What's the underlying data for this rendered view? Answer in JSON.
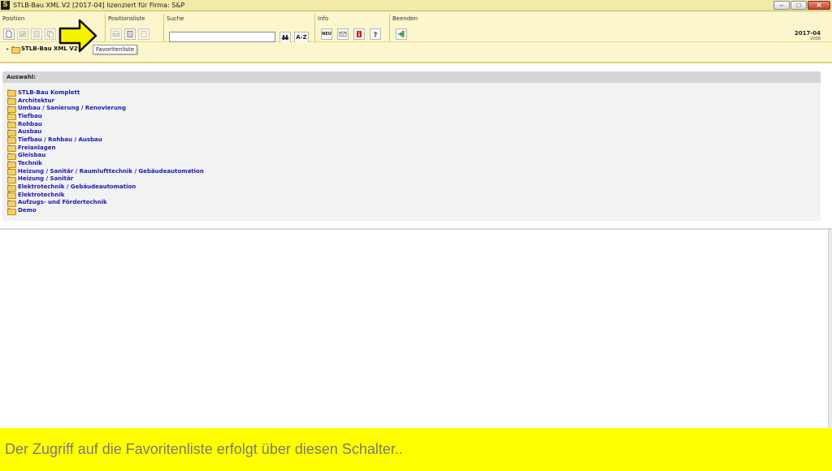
{
  "window": {
    "app_icon": "S",
    "title": "STLB-Bau XML V2 [2017-04] lizenziert für Firma: S&P",
    "controls": {
      "minimize": "–",
      "maximize": "□",
      "close": "✕"
    }
  },
  "ribbon": {
    "groups": {
      "position": {
        "label": "Position"
      },
      "positionsliste": {
        "label": "Positionsliste"
      },
      "suche": {
        "label": "Suche",
        "search_value": "",
        "binoculars_icon": "binoculars-icon",
        "az_label": "A-Z"
      },
      "info": {
        "label": "Info",
        "new_label": "NEU"
      },
      "beenden": {
        "label": "Beenden"
      }
    },
    "version": {
      "label": "2017-04",
      "sub": "0008"
    }
  },
  "tree": {
    "root_label": "STLB-Bau XML V2",
    "tooltip": "Favoritenliste"
  },
  "auswahl": {
    "header": "Auswahl:",
    "items": [
      "STLB-Bau Komplett",
      "Architektur",
      "Umbau / Sanierung / Renovierung",
      "Tiefbau",
      "Rohbau",
      "Ausbau",
      "Tiefbau / Rohbau / Ausbau",
      "Freianlagen",
      "Gleisbau",
      "Technik",
      "Heizung / Sanitär / Raumlufttechnik / Gebäudeautomation",
      "Heizung / Sanitär",
      "Elektrotechnik / Gebäudeautomation",
      "Elektrotechnik",
      "Aufzugs- und Fördertechnik",
      "Demo"
    ]
  },
  "caption": {
    "text": "Der Zugriff auf die Favoritenliste erfolgt über diesen Schalter.."
  },
  "colors": {
    "ribbon_bg": "#fbf6cc",
    "caption_bg": "#ffff00",
    "link": "#1a1ab0",
    "arrow_fill": "#f6f200"
  }
}
